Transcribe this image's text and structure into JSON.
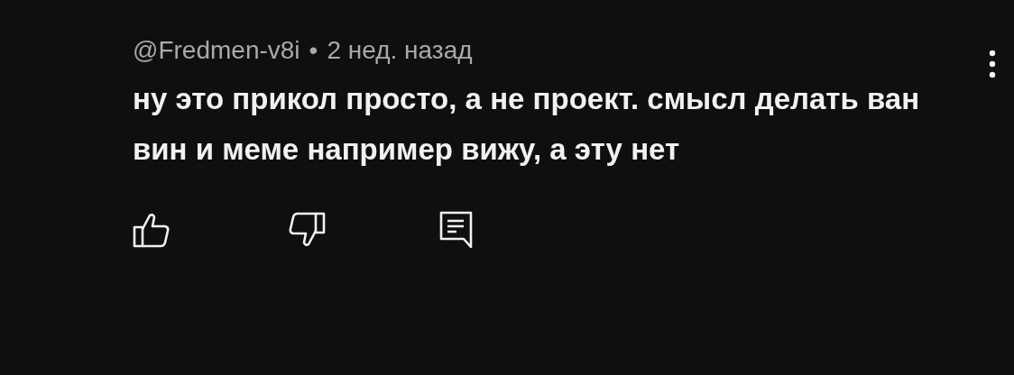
{
  "comment": {
    "author": "@Fredmen-v8i",
    "separator": "•",
    "time": "2 нед. назад",
    "text": "ну это прикол просто, а не проект. смысл делать ван вин и меме например вижу, а эту нет"
  }
}
